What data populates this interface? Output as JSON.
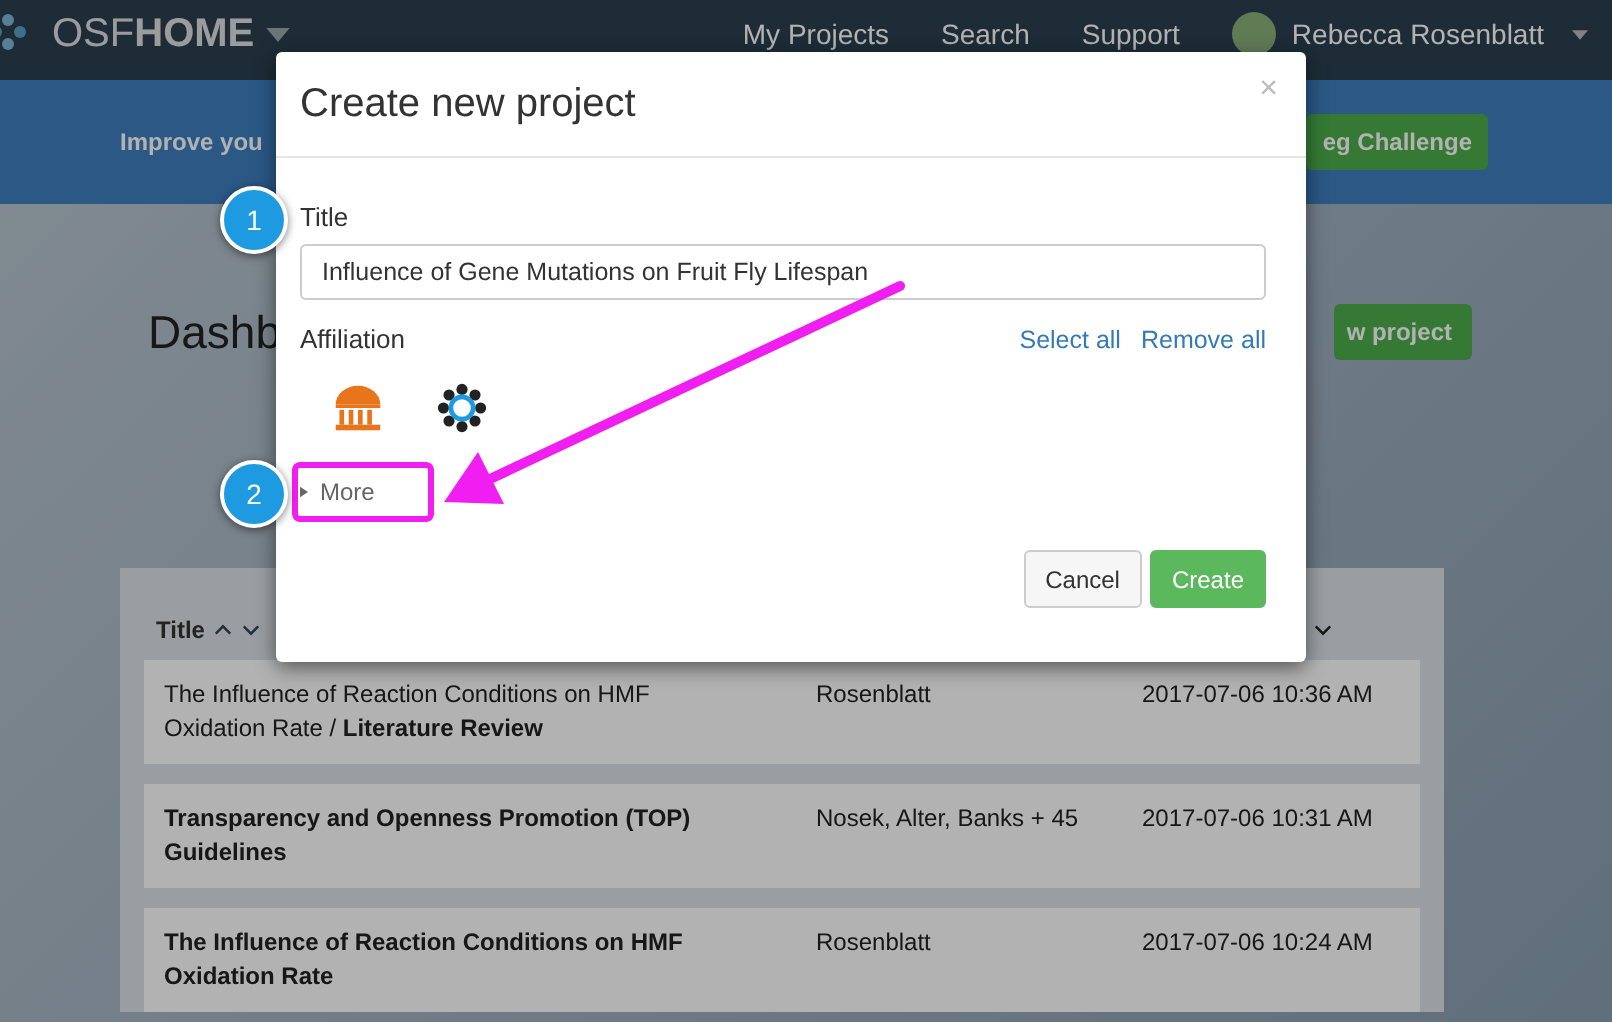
{
  "navbar": {
    "brand": "OSF",
    "brand_bold": "HOME",
    "links": [
      "My Projects",
      "Search",
      "Support"
    ],
    "user": "Rebecca Rosenblatt"
  },
  "banner": {
    "text": "Improve you",
    "button": "eg Challenge"
  },
  "dashboard": {
    "heading": "Dashb",
    "button": "w project"
  },
  "table": {
    "columns": [
      {
        "label": "Title"
      }
    ],
    "rows": [
      {
        "title": "The Influence of Reaction Conditions on HMF Oxidation Rate / **Literature Review**",
        "bold": false,
        "contributors": "Rosenblatt",
        "modified": "2017-07-06 10:36 AM"
      },
      {
        "title": "Transparency and Openness Promotion (TOP) Guidelines",
        "bold": true,
        "contributors": "Nosek, Alter, Banks + 45",
        "modified": "2017-07-06 10:31 AM"
      },
      {
        "title": "The Influence of Reaction Conditions on HMF Oxidation Rate",
        "bold": true,
        "contributors": "Rosenblatt",
        "modified": "2017-07-06 10:24 AM"
      }
    ]
  },
  "dialog": {
    "title": "Create new project",
    "close": "×",
    "title_label": "Title",
    "title_value": "Influence of Gene Mutations on Fruit Fly Lifespan",
    "affiliation_label": "Affiliation",
    "select_all": "Select all",
    "remove_all": "Remove all",
    "more": "More",
    "buttons": [
      {
        "label": "Cancel",
        "kind": "default"
      },
      {
        "label": "Create",
        "kind": "primary"
      }
    ]
  },
  "annotations": [
    {
      "number": "1"
    },
    {
      "number": "2"
    }
  ]
}
